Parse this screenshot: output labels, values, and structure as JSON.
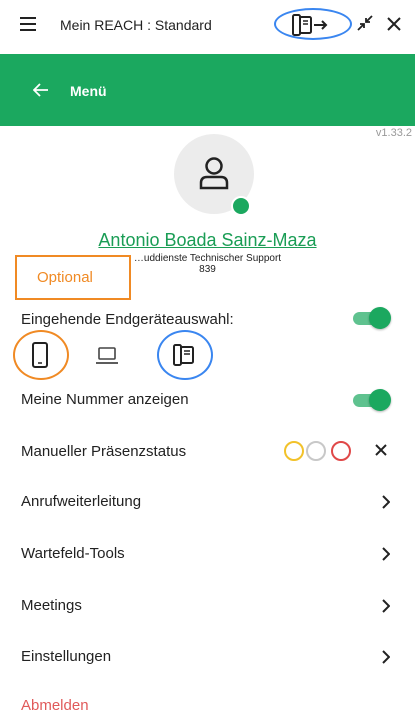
{
  "titlebar": {
    "title": "Mein REACH : Standard",
    "menu_icon": "hamburger-icon",
    "switch_icon": "device-switch-icon",
    "minimize_icon": "minimize-icon",
    "close_icon": "close-icon"
  },
  "menubar": {
    "back_icon": "arrow-left-icon",
    "title": "Menü"
  },
  "version": "v1.33.2",
  "user": {
    "name": "Antonio Boada Sainz-Maza",
    "department": "…uddienste Technischer Support",
    "extension": "839",
    "presence_color": "#1ba85f"
  },
  "annotation": {
    "optional_label": "Optional"
  },
  "incoming_devices": {
    "label": "Eingehende Endgeräteauswahl:",
    "enabled": true,
    "devices": [
      "mobile-phone-icon",
      "laptop-icon",
      "desk-phone-icon"
    ]
  },
  "show_number": {
    "label": "Meine Nummer anzeigen",
    "enabled": true
  },
  "manual_presence": {
    "label": "Manueller Präsenzstatus",
    "options": [
      {
        "name": "yellow",
        "color": "#f2c22a"
      },
      {
        "name": "grey",
        "color": "#c8c8c8"
      },
      {
        "name": "red",
        "color": "#e04848"
      }
    ]
  },
  "nav_items": [
    {
      "label": "Anrufweiterleitung"
    },
    {
      "label": "Wartefeld-Tools"
    },
    {
      "label": "Meetings"
    },
    {
      "label": "Einstellungen"
    }
  ],
  "logout": "Abmelden",
  "colors": {
    "accent": "#1ba85f",
    "highlight_blue": "#3a86f0",
    "highlight_orange": "#f08a24",
    "logout": "#e05a5a"
  }
}
